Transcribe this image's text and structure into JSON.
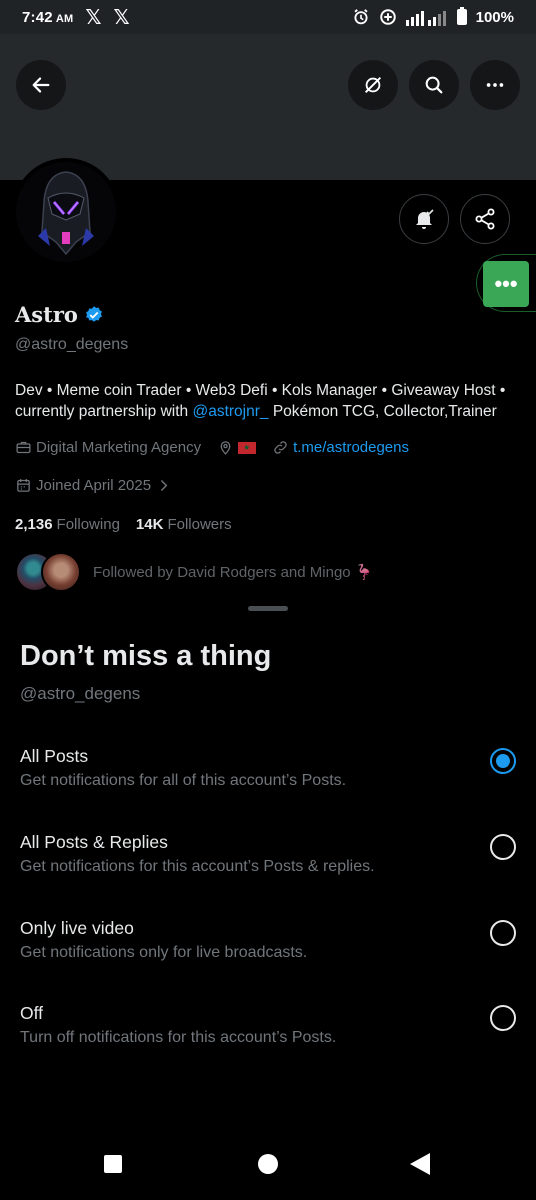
{
  "status_bar": {
    "time": "7:42",
    "ampm": "AM",
    "app_icons": [
      "𝕏",
      "𝕏"
    ],
    "battery": "100%",
    "network": "LTE"
  },
  "header": {
    "back_icon": "arrow-left-icon",
    "grok_icon": "grok-icon",
    "search_icon": "search-icon",
    "more_icon": "more-horizontal-icon"
  },
  "profile": {
    "name": "Astro",
    "handle": "@astro_degens",
    "bio_text_1": "Dev • Meme coin Trader • Web3 Defi • Kols Manager • Giveaway Host • currently partnership with ",
    "bio_mention": "@astrojnr_",
    "bio_text_2": " Pokémon TCG, Collector,Trainer",
    "category": "Digital Marketing Agency",
    "website": "t.me/astrodegens",
    "joined": "Joined April 2025",
    "following_count": "2,136",
    "following_label": "Following",
    "followers_count": "14K",
    "followers_label": "Followers",
    "followed_by": "Followed by David Rodgers and Mingo 🦩",
    "more_button": "•••"
  },
  "sheet": {
    "title": "Don’t miss a thing",
    "handle": "@astro_degens",
    "options": [
      {
        "title": "All Posts",
        "subtitle": "Get notifications for all of this account’s Posts.",
        "selected": true
      },
      {
        "title": "All Posts & Replies",
        "subtitle": "Get notifications for this account’s Posts & replies.",
        "selected": false
      },
      {
        "title": "Only live video",
        "subtitle": "Get notifications only for live broadcasts.",
        "selected": false
      },
      {
        "title": "Off",
        "subtitle": "Turn off notifications for this account’s Posts.",
        "selected": false
      }
    ]
  },
  "colors": {
    "accent": "#1d9bf0",
    "secondary_text": "#71767b",
    "green_button": "#3aa757"
  }
}
